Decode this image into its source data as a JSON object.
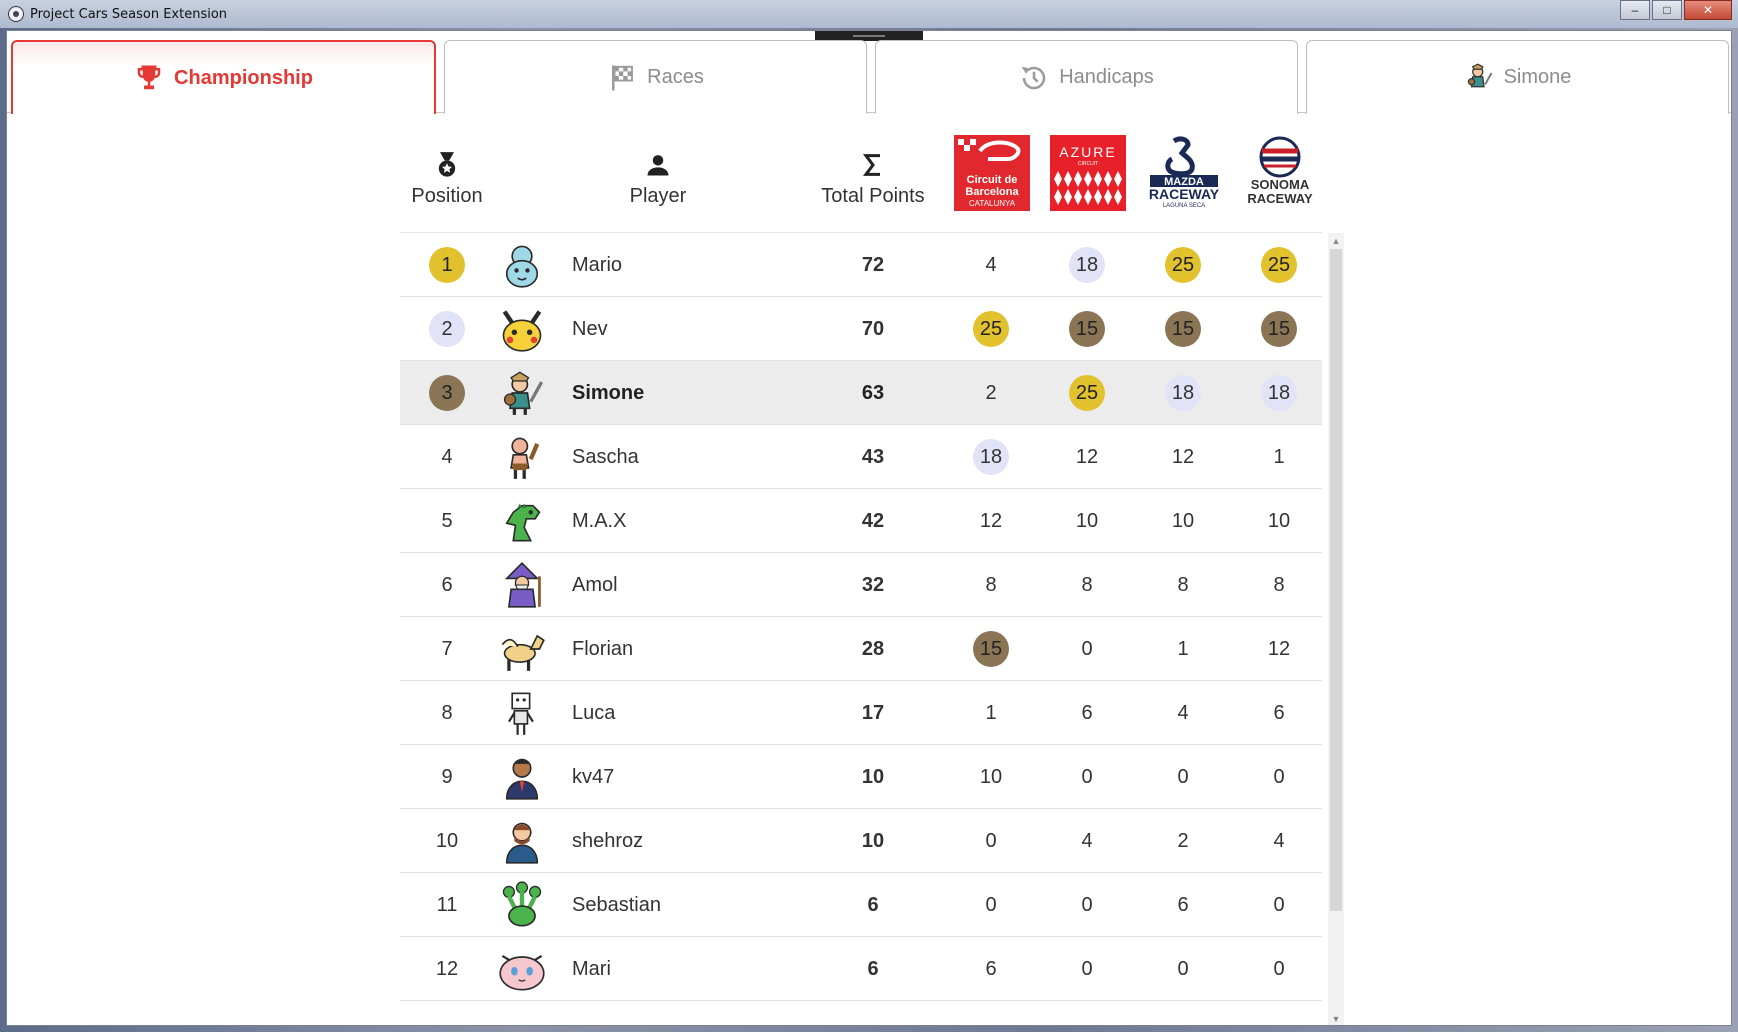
{
  "window": {
    "title": "Project Cars Season Extension"
  },
  "tabs": [
    {
      "label": "Championship",
      "icon": "trophy-icon"
    },
    {
      "label": "Races",
      "icon": "checkered-flag-icon"
    },
    {
      "label": "Handicaps",
      "icon": "history-icon"
    },
    {
      "label": "Simone",
      "icon": "knight-avatar-icon"
    }
  ],
  "header": {
    "position": "Position",
    "player": "Player",
    "total": "Total Points",
    "tracks": [
      {
        "logo_text": "Circuit de Barcelona CATALUNYA"
      },
      {
        "logo_text": "AZURE CIRCUIT"
      },
      {
        "logo_text": "MAZDA RACEWAY LAGUNA SECA"
      },
      {
        "logo_text": "SONOMA RACEWAY"
      }
    ]
  },
  "rows": [
    {
      "position": "1",
      "medal": "gold",
      "name": "Mario",
      "total": "72",
      "points": [
        "4",
        "18",
        "25",
        "25"
      ],
      "badges": [
        "",
        "silver",
        "gold",
        "gold"
      ],
      "avatar": "squirtle-avatar-icon"
    },
    {
      "position": "2",
      "medal": "silver",
      "name": "Nev",
      "total": "70",
      "points": [
        "25",
        "15",
        "15",
        "15"
      ],
      "badges": [
        "gold",
        "bronze",
        "bronze",
        "bronze"
      ],
      "avatar": "pikachu-avatar-icon"
    },
    {
      "position": "3",
      "medal": "bronze",
      "name": "Simone",
      "total": "63",
      "points": [
        "2",
        "25",
        "18",
        "18"
      ],
      "badges": [
        "",
        "gold",
        "silver",
        "silver"
      ],
      "avatar": "knight-avatar-icon",
      "highlight": true
    },
    {
      "position": "4",
      "medal": "",
      "name": "Sascha",
      "total": "43",
      "points": [
        "18",
        "12",
        "12",
        "1"
      ],
      "badges": [
        "silver",
        "",
        "",
        ""
      ],
      "avatar": "caveman-avatar-icon"
    },
    {
      "position": "5",
      "medal": "",
      "name": "M.A.X",
      "total": "42",
      "points": [
        "12",
        "10",
        "10",
        "10"
      ],
      "badges": [
        "",
        "",
        "",
        ""
      ],
      "avatar": "dinosaur-avatar-icon"
    },
    {
      "position": "6",
      "medal": "",
      "name": "Amol",
      "total": "32",
      "points": [
        "8",
        "8",
        "8",
        "8"
      ],
      "badges": [
        "",
        "",
        "",
        ""
      ],
      "avatar": "wizard-avatar-icon"
    },
    {
      "position": "7",
      "medal": "",
      "name": "Florian",
      "total": "28",
      "points": [
        "15",
        "0",
        "1",
        "12"
      ],
      "badges": [
        "bronze",
        "",
        "",
        ""
      ],
      "avatar": "pegasus-avatar-icon"
    },
    {
      "position": "8",
      "medal": "",
      "name": "Luca",
      "total": "17",
      "points": [
        "1",
        "6",
        "4",
        "6"
      ],
      "badges": [
        "",
        "",
        "",
        ""
      ],
      "avatar": "robot-avatar-icon"
    },
    {
      "position": "9",
      "medal": "",
      "name": "kv47",
      "total": "10",
      "points": [
        "10",
        "0",
        "0",
        "0"
      ],
      "badges": [
        "",
        "",
        "",
        ""
      ],
      "avatar": "businessman-avatar-icon"
    },
    {
      "position": "10",
      "medal": "",
      "name": "shehroz",
      "total": "10",
      "points": [
        "0",
        "4",
        "2",
        "4"
      ],
      "badges": [
        "",
        "",
        "",
        ""
      ],
      "avatar": "bearded-man-avatar-icon"
    },
    {
      "position": "11",
      "medal": "",
      "name": "Sebastian",
      "total": "6",
      "points": [
        "0",
        "0",
        "6",
        "0"
      ],
      "badges": [
        "",
        "",
        "",
        ""
      ],
      "avatar": "hydra-avatar-icon"
    },
    {
      "position": "12",
      "medal": "",
      "name": "Mari",
      "total": "6",
      "points": [
        "6",
        "0",
        "0",
        "0"
      ],
      "badges": [
        "",
        "",
        "",
        ""
      ],
      "avatar": "mew-avatar-icon"
    }
  ],
  "colors": {
    "accent": "#e53935",
    "gold": "#e2c12e",
    "silver": "#e1e3f6",
    "bronze": "#8a7555"
  }
}
